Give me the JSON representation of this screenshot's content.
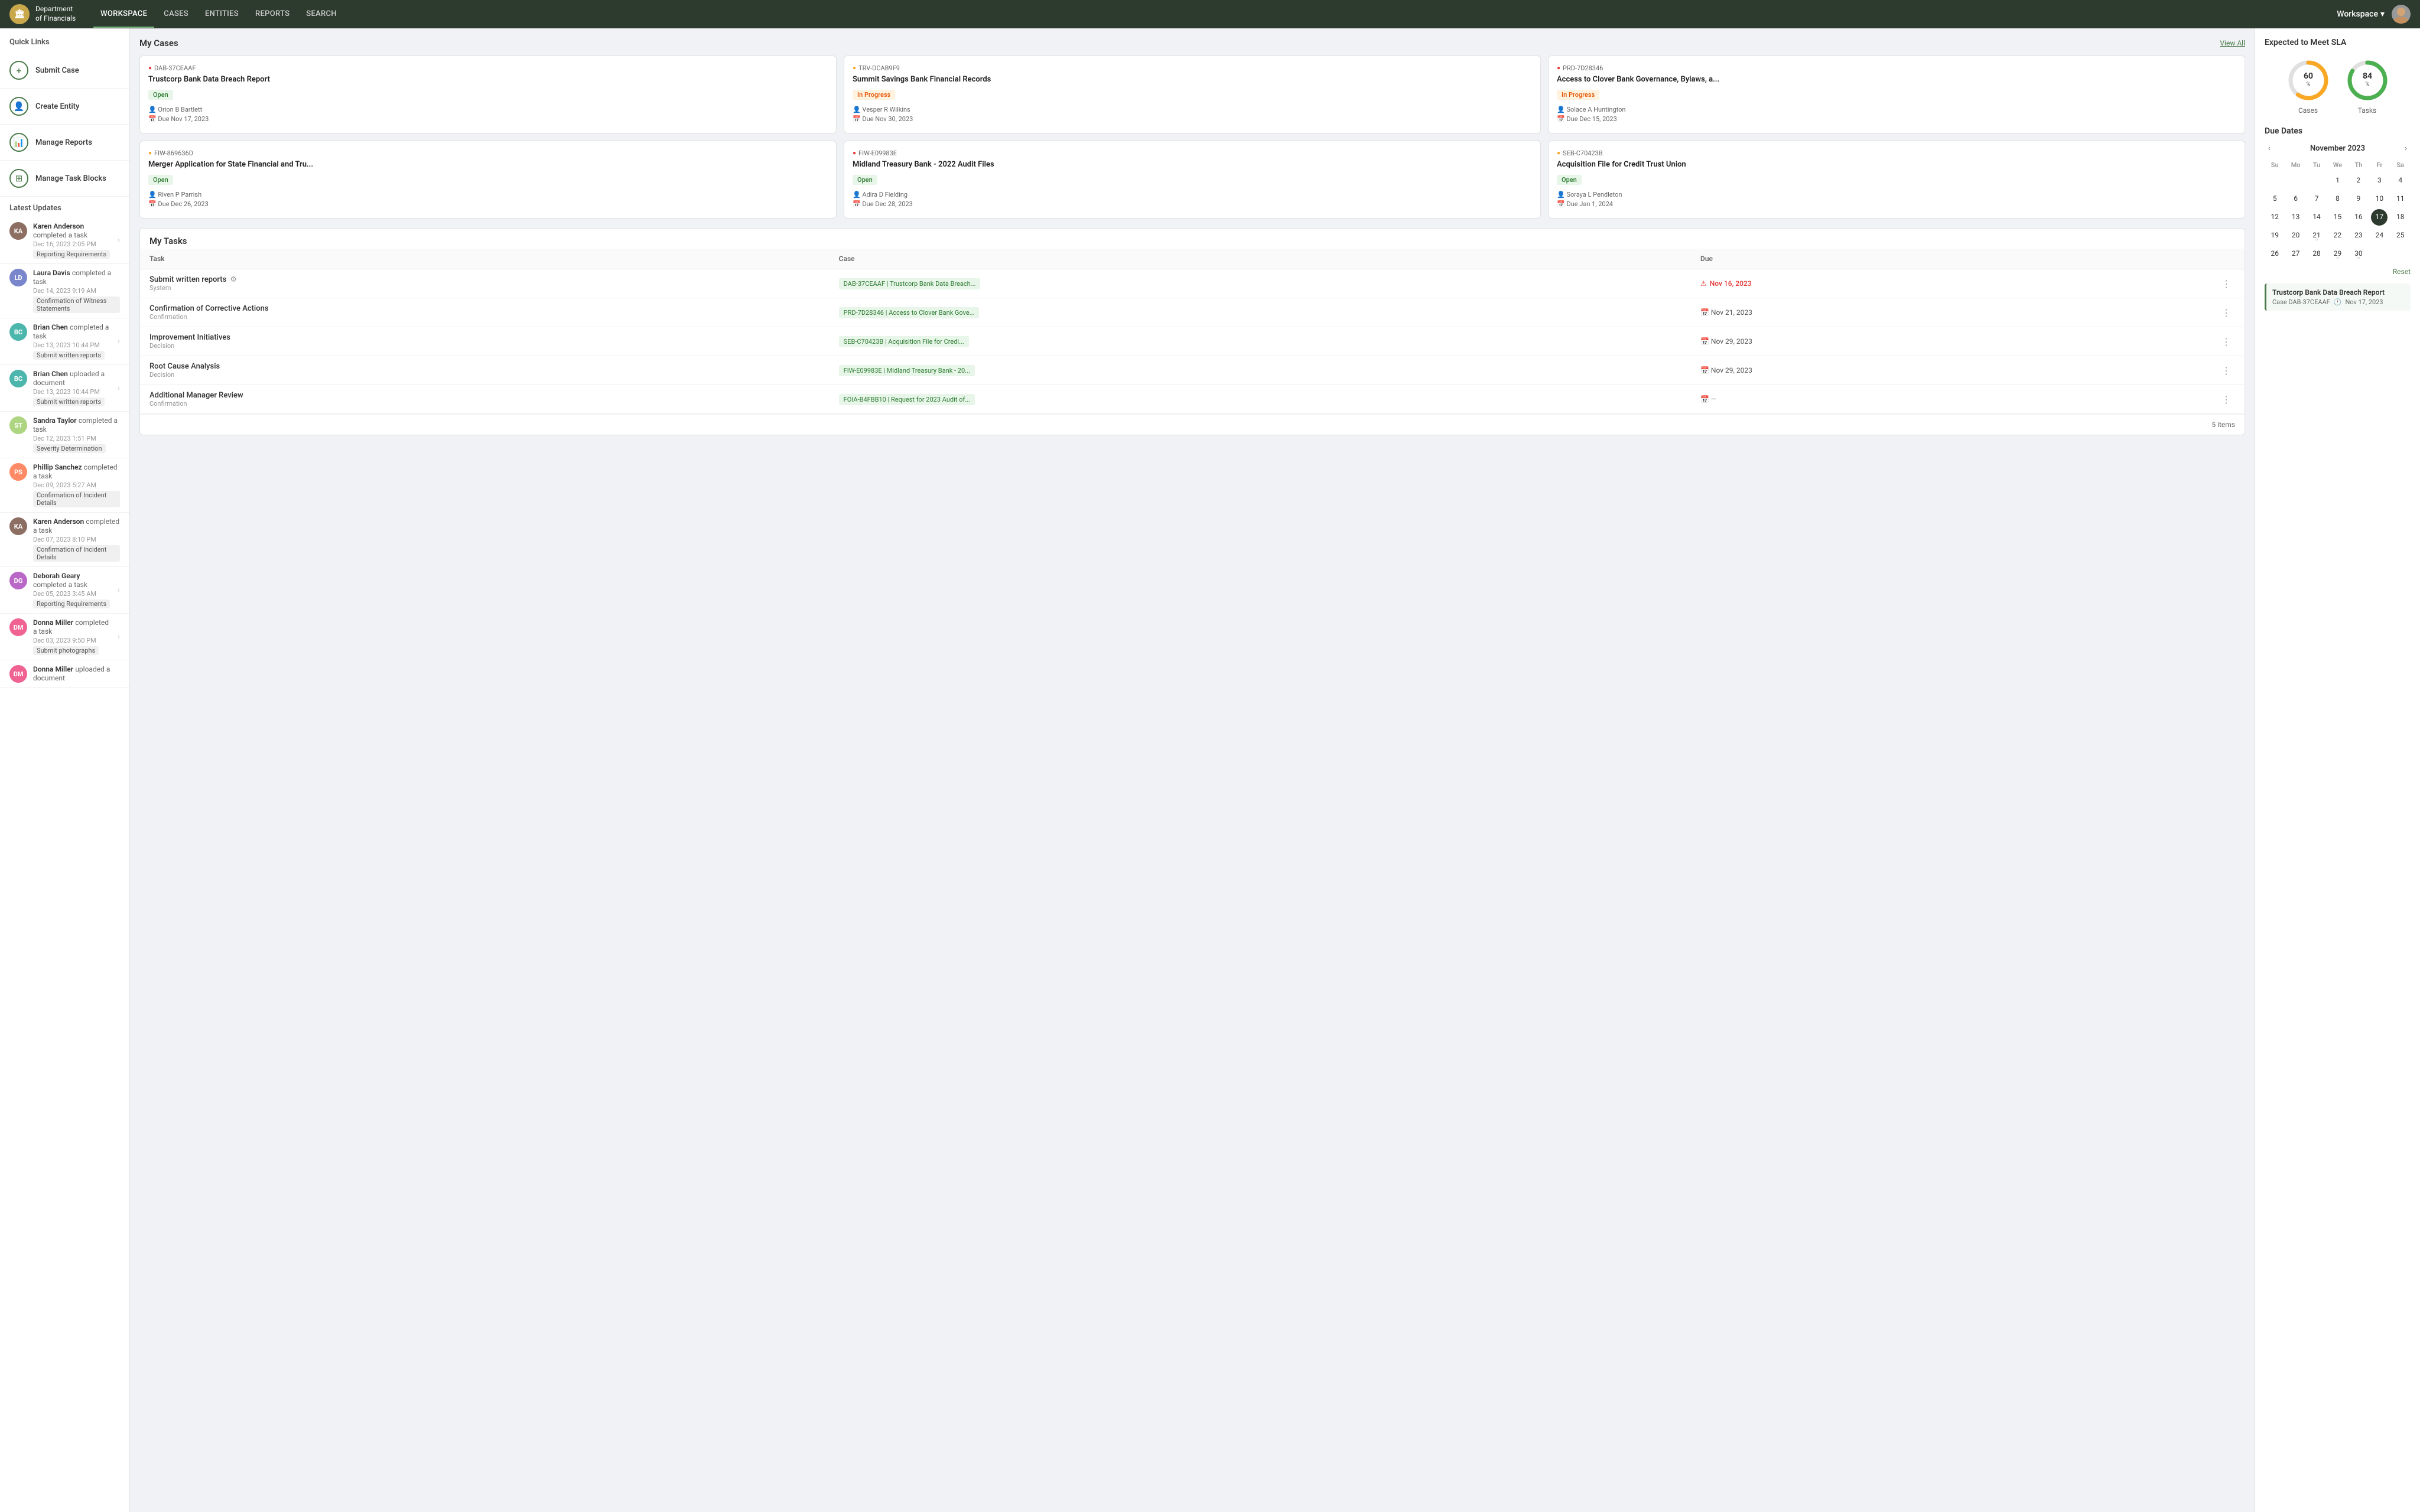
{
  "nav": {
    "logo_text": "Department\nof Financials",
    "links": [
      "WORKSPACE",
      "CASES",
      "ENTITIES",
      "REPORTS",
      "SEARCH"
    ],
    "active_link": "WORKSPACE",
    "workspace_label": "Workspace",
    "dropdown_arrow": "▾"
  },
  "quick_links": {
    "title": "Quick Links",
    "items": [
      {
        "id": "submit-case",
        "label": "Submit Case",
        "icon": "+"
      },
      {
        "id": "create-entity",
        "label": "Create Entity",
        "icon": "👤"
      },
      {
        "id": "manage-reports",
        "label": "Manage Reports",
        "icon": "📊"
      },
      {
        "id": "manage-task-blocks",
        "label": "Manage Task Blocks",
        "icon": "⊞"
      }
    ]
  },
  "latest_updates": {
    "title": "Latest Updates",
    "items": [
      {
        "name": "Karen Anderson",
        "action": "completed a task",
        "date": "Dec 16, 2023 2:05 PM",
        "task": "Reporting Requirements",
        "initials": "KA",
        "color": "#8d6e63",
        "has_arrow": true
      },
      {
        "name": "Laura Davis",
        "action": "completed a task",
        "date": "Dec 14, 2023 9:19 AM",
        "task": "Confirmation of Witness Statements",
        "initials": "LD",
        "color": "#7986cb",
        "has_arrow": false
      },
      {
        "name": "Brian Chen",
        "action": "completed a task",
        "date": "Dec 13, 2023 10:44 PM",
        "task": "Submit written reports",
        "initials": "BC",
        "color": "#4db6ac",
        "has_arrow": true
      },
      {
        "name": "Brian Chen",
        "action": "uploaded a document",
        "date": "Dec 13, 2023 10:44 PM",
        "task": "Submit written reports",
        "initials": "BC",
        "color": "#4db6ac",
        "has_arrow": true
      },
      {
        "name": "Sandra Taylor",
        "action": "completed a task",
        "date": "Dec 12, 2023 1:51 PM",
        "task": "Severity Determination",
        "initials": "ST",
        "color": "#aed581",
        "has_arrow": false
      },
      {
        "name": "Phillip Sanchez",
        "action": "completed a task",
        "date": "Dec 09, 2023 5:27 AM",
        "task": "Confirmation of Incident Details",
        "initials": "PS",
        "color": "#ff8a65",
        "has_arrow": false
      },
      {
        "name": "Karen Anderson",
        "action": "completed a task",
        "date": "Dec 07, 2023 8:10 PM",
        "task": "Confirmation of Incident Details",
        "initials": "KA",
        "color": "#8d6e63",
        "has_arrow": false
      },
      {
        "name": "Deborah Geary",
        "action": "completed a task",
        "date": "Dec 05, 2023 3:45 AM",
        "task": "Reporting Requirements",
        "initials": "DG",
        "color": "#ba68c8",
        "has_arrow": true
      },
      {
        "name": "Donna Miller",
        "action": "completed a task",
        "date": "Dec 03, 2023 9:50 PM",
        "task": "Submit photographs",
        "initials": "DM",
        "color": "#f06292",
        "has_arrow": true
      },
      {
        "name": "Donna Miller",
        "action": "uploaded a document",
        "date": "",
        "task": "",
        "initials": "DM",
        "color": "#f06292",
        "has_arrow": false
      }
    ]
  },
  "my_cases": {
    "title": "My Cases",
    "view_all": "View All",
    "cases": [
      {
        "priority": "high",
        "id": "DAB-37CEAAF",
        "title": "Trustcorp Bank Data Breach Report",
        "status": "Open",
        "status_type": "open",
        "person": "Orion B Bartlett",
        "due": "Due Nov 17, 2023"
      },
      {
        "priority": "medium",
        "id": "TRV-DCAB9F9",
        "title": "Summit Savings Bank Financial Records",
        "status": "In Progress",
        "status_type": "progress",
        "person": "Vesper R Wilkins",
        "due": "Due Nov 30, 2023"
      },
      {
        "priority": "high",
        "id": "PRD-7D28346",
        "title": "Access to Clover Bank Governance, Bylaws, a...",
        "status": "In Progress",
        "status_type": "progress",
        "person": "Solace A Huntington",
        "due": "Due Dec 15, 2023"
      },
      {
        "priority": "medium",
        "id": "FIW-869636D",
        "title": "Merger Application for State Financial and Tru...",
        "status": "Open",
        "status_type": "open",
        "person": "Riven P Parrish",
        "due": "Due Dec 26, 2023"
      },
      {
        "priority": "high",
        "id": "FIW-E09983E",
        "title": "Midland Treasury Bank - 2022 Audit Files",
        "status": "Open",
        "status_type": "open",
        "person": "Adira D Fielding",
        "due": "Due Dec 28, 2023"
      },
      {
        "priority": "medium",
        "id": "SEB-C70423B",
        "title": "Acquisition File for Credit Trust Union",
        "status": "Open",
        "status_type": "open",
        "person": "Soraya L Pendleton",
        "due": "Due Jan 1, 2024"
      }
    ]
  },
  "my_tasks": {
    "title": "My Tasks",
    "columns": [
      "Task",
      "Case",
      "Due"
    ],
    "items_count": "5 items",
    "tasks": [
      {
        "name": "Submit written reports",
        "has_gear": true,
        "type": "System",
        "case": "DAB-37CEAAF | Trustcorp Bank Data Breach...",
        "due": "Nov 16, 2023",
        "due_overdue": true,
        "due_icon": "overdue"
      },
      {
        "name": "Confirmation of Corrective Actions",
        "has_gear": false,
        "type": "Confirmation",
        "case": "PRD-7D28346 | Access to Clover Bank Gove...",
        "due": "Nov 21, 2023",
        "due_overdue": false,
        "due_icon": "clock"
      },
      {
        "name": "Improvement Initiatives",
        "has_gear": false,
        "type": "Decision",
        "case": "SEB-C70423B | Acquisition File for Credi...",
        "due": "Nov 29, 2023",
        "due_overdue": false,
        "due_icon": "calendar"
      },
      {
        "name": "Root Cause Analysis",
        "has_gear": false,
        "type": "Decision",
        "case": "FIW-E09983E | Midland Treasury Bank - 20...",
        "due": "Nov 29, 2023",
        "due_overdue": false,
        "due_icon": "calendar"
      },
      {
        "name": "Additional Manager Review",
        "has_gear": false,
        "type": "Confirmation",
        "case": "FOIA-B4FBB10 | Request for 2023 Audit of...",
        "due": "—",
        "due_overdue": false,
        "due_icon": "calendar"
      }
    ]
  },
  "sla": {
    "title": "Expected to Meet SLA",
    "cases_pct": 60,
    "tasks_pct": 84,
    "cases_label": "Cases",
    "tasks_label": "Tasks"
  },
  "due_dates": {
    "title": "Due Dates",
    "month": "November 2023",
    "day_headers": [
      "Su",
      "Mo",
      "Tu",
      "We",
      "Th",
      "Fr",
      "Sa"
    ],
    "reset_label": "Reset",
    "event": {
      "title": "Trustcorp Bank Data Breach Report",
      "case_id": "Case DAB-37CEAAF",
      "date": "Nov 17, 2023"
    }
  }
}
